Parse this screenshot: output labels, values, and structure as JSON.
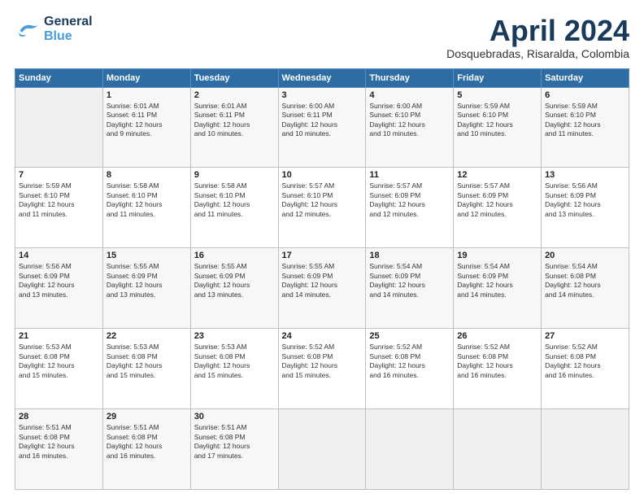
{
  "logo": {
    "general": "General",
    "blue": "Blue"
  },
  "title": "April 2024",
  "location": "Dosquebradas, Risaralda, Colombia",
  "weekdays": [
    "Sunday",
    "Monday",
    "Tuesday",
    "Wednesday",
    "Thursday",
    "Friday",
    "Saturday"
  ],
  "weeks": [
    [
      {
        "day": "",
        "info": ""
      },
      {
        "day": "1",
        "info": "Sunrise: 6:01 AM\nSunset: 6:11 PM\nDaylight: 12 hours\nand 9 minutes."
      },
      {
        "day": "2",
        "info": "Sunrise: 6:01 AM\nSunset: 6:11 PM\nDaylight: 12 hours\nand 10 minutes."
      },
      {
        "day": "3",
        "info": "Sunrise: 6:00 AM\nSunset: 6:11 PM\nDaylight: 12 hours\nand 10 minutes."
      },
      {
        "day": "4",
        "info": "Sunrise: 6:00 AM\nSunset: 6:10 PM\nDaylight: 12 hours\nand 10 minutes."
      },
      {
        "day": "5",
        "info": "Sunrise: 5:59 AM\nSunset: 6:10 PM\nDaylight: 12 hours\nand 10 minutes."
      },
      {
        "day": "6",
        "info": "Sunrise: 5:59 AM\nSunset: 6:10 PM\nDaylight: 12 hours\nand 11 minutes."
      }
    ],
    [
      {
        "day": "7",
        "info": "Sunrise: 5:59 AM\nSunset: 6:10 PM\nDaylight: 12 hours\nand 11 minutes."
      },
      {
        "day": "8",
        "info": "Sunrise: 5:58 AM\nSunset: 6:10 PM\nDaylight: 12 hours\nand 11 minutes."
      },
      {
        "day": "9",
        "info": "Sunrise: 5:58 AM\nSunset: 6:10 PM\nDaylight: 12 hours\nand 11 minutes."
      },
      {
        "day": "10",
        "info": "Sunrise: 5:57 AM\nSunset: 6:10 PM\nDaylight: 12 hours\nand 12 minutes."
      },
      {
        "day": "11",
        "info": "Sunrise: 5:57 AM\nSunset: 6:09 PM\nDaylight: 12 hours\nand 12 minutes."
      },
      {
        "day": "12",
        "info": "Sunrise: 5:57 AM\nSunset: 6:09 PM\nDaylight: 12 hours\nand 12 minutes."
      },
      {
        "day": "13",
        "info": "Sunrise: 5:56 AM\nSunset: 6:09 PM\nDaylight: 12 hours\nand 13 minutes."
      }
    ],
    [
      {
        "day": "14",
        "info": "Sunrise: 5:56 AM\nSunset: 6:09 PM\nDaylight: 12 hours\nand 13 minutes."
      },
      {
        "day": "15",
        "info": "Sunrise: 5:55 AM\nSunset: 6:09 PM\nDaylight: 12 hours\nand 13 minutes."
      },
      {
        "day": "16",
        "info": "Sunrise: 5:55 AM\nSunset: 6:09 PM\nDaylight: 12 hours\nand 13 minutes."
      },
      {
        "day": "17",
        "info": "Sunrise: 5:55 AM\nSunset: 6:09 PM\nDaylight: 12 hours\nand 14 minutes."
      },
      {
        "day": "18",
        "info": "Sunrise: 5:54 AM\nSunset: 6:09 PM\nDaylight: 12 hours\nand 14 minutes."
      },
      {
        "day": "19",
        "info": "Sunrise: 5:54 AM\nSunset: 6:09 PM\nDaylight: 12 hours\nand 14 minutes."
      },
      {
        "day": "20",
        "info": "Sunrise: 5:54 AM\nSunset: 6:08 PM\nDaylight: 12 hours\nand 14 minutes."
      }
    ],
    [
      {
        "day": "21",
        "info": "Sunrise: 5:53 AM\nSunset: 6:08 PM\nDaylight: 12 hours\nand 15 minutes."
      },
      {
        "day": "22",
        "info": "Sunrise: 5:53 AM\nSunset: 6:08 PM\nDaylight: 12 hours\nand 15 minutes."
      },
      {
        "day": "23",
        "info": "Sunrise: 5:53 AM\nSunset: 6:08 PM\nDaylight: 12 hours\nand 15 minutes."
      },
      {
        "day": "24",
        "info": "Sunrise: 5:52 AM\nSunset: 6:08 PM\nDaylight: 12 hours\nand 15 minutes."
      },
      {
        "day": "25",
        "info": "Sunrise: 5:52 AM\nSunset: 6:08 PM\nDaylight: 12 hours\nand 16 minutes."
      },
      {
        "day": "26",
        "info": "Sunrise: 5:52 AM\nSunset: 6:08 PM\nDaylight: 12 hours\nand 16 minutes."
      },
      {
        "day": "27",
        "info": "Sunrise: 5:52 AM\nSunset: 6:08 PM\nDaylight: 12 hours\nand 16 minutes."
      }
    ],
    [
      {
        "day": "28",
        "info": "Sunrise: 5:51 AM\nSunset: 6:08 PM\nDaylight: 12 hours\nand 16 minutes."
      },
      {
        "day": "29",
        "info": "Sunrise: 5:51 AM\nSunset: 6:08 PM\nDaylight: 12 hours\nand 16 minutes."
      },
      {
        "day": "30",
        "info": "Sunrise: 5:51 AM\nSunset: 6:08 PM\nDaylight: 12 hours\nand 17 minutes."
      },
      {
        "day": "",
        "info": ""
      },
      {
        "day": "",
        "info": ""
      },
      {
        "day": "",
        "info": ""
      },
      {
        "day": "",
        "info": ""
      }
    ]
  ]
}
